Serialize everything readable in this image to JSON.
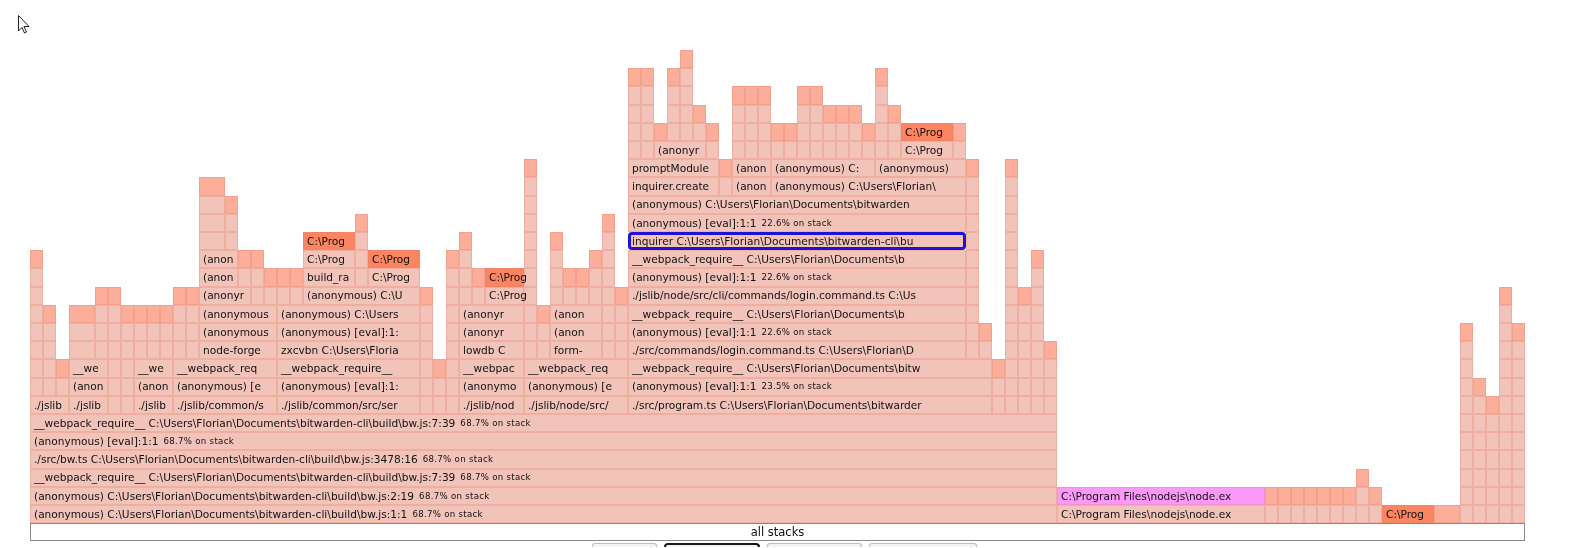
{
  "flame_graph": {
    "rows": [
      {
        "frames": [
          {
            "label": "C:\\Prog",
            "color": "#fa8560",
            "selected": false
          }
        ]
      },
      {
        "frames": [
          {
            "label": "(anonyr",
            "color": "#f2c3b9",
            "selected": false
          },
          {
            "label": "C:\\Prog",
            "color": "#f2c3b9",
            "selected": false
          }
        ]
      },
      {
        "frames": [
          {
            "label": "promptModule",
            "color": "#f2c3b9",
            "selected": false
          },
          {
            "label": "(anon",
            "color": "#f2c3b9",
            "selected": false
          },
          {
            "label": "(anonymous) C:",
            "color": "#f2c3b9",
            "selected": false
          },
          {
            "label": "(anonymous)",
            "color": "#f2c3b9",
            "selected": false
          }
        ]
      },
      {
        "frames": [
          {
            "label": "inquirer.create",
            "color": "#f2c3b9",
            "selected": false
          },
          {
            "label": "(anon",
            "color": "#f2c3b9",
            "selected": false
          },
          {
            "label": "(anonymous) C:\\Users\\Florian\\",
            "color": "#f2c3b9",
            "selected": false
          }
        ]
      },
      {
        "frames": [
          {
            "label": "(anonymous) C:\\Users\\Florian\\Documents\\bitwarden",
            "color": "#f2c3b9",
            "selected": false
          }
        ]
      },
      {
        "frames": [
          {
            "label": "(anonymous) [eval]:1:1",
            "share": "22.6% on stack",
            "color": "#f2c3b9",
            "selected": false
          }
        ]
      },
      {
        "frames": [
          {
            "label": "C:\\Prog",
            "color": "#fa8560",
            "selected": false
          },
          {
            "label": "inquirer C:\\Users\\Florian\\Documents\\bitwarden-cli\\bu",
            "color": "#f2c3b9",
            "selected": true
          }
        ]
      },
      {
        "frames": [
          {
            "label": "(anon",
            "color": "#f2c3b9",
            "selected": false
          },
          {
            "label": "C:\\Prog",
            "color": "#f2c3b9",
            "selected": false
          },
          {
            "label": "C:\\Prog",
            "color": "#fa8560",
            "selected": false
          },
          {
            "label": "__webpack_require__ C:\\Users\\Florian\\Documents\\b",
            "color": "#f2c3b9",
            "selected": false
          }
        ]
      },
      {
        "frames": [
          {
            "label": "(anon",
            "color": "#f2c3b9",
            "selected": false
          },
          {
            "label": "build_ra",
            "color": "#f2c3b9",
            "selected": false
          },
          {
            "label": "C:\\Prog",
            "color": "#f2c3b9",
            "selected": false
          },
          {
            "label": "C:\\Prog",
            "color": "#fa8560",
            "selected": false
          },
          {
            "label": "(anonymous) [eval]:1:1",
            "share": "22.6% on stack",
            "color": "#f2c3b9",
            "selected": false
          }
        ]
      },
      {
        "frames": [
          {
            "label": "(anonyr",
            "color": "#f2c3b9",
            "selected": false
          },
          {
            "label": "(anonymous) C:\\U",
            "color": "#f2c3b9",
            "selected": false
          },
          {
            "label": "C:\\Prog",
            "color": "#f2c3b9",
            "selected": false
          },
          {
            "label": "./jslib/node/src/cli/commands/login.command.ts C:\\Us",
            "color": "#f2c3b9",
            "selected": false
          }
        ]
      },
      {
        "frames": [
          {
            "label": "(anonymous",
            "color": "#f2c3b9",
            "selected": false
          },
          {
            "label": "(anonymous) C:\\Users",
            "color": "#f2c3b9",
            "selected": false
          },
          {
            "label": "(anonyr",
            "color": "#f2c3b9",
            "selected": false
          },
          {
            "label": "(anon",
            "color": "#f2c3b9",
            "selected": false
          },
          {
            "label": "__webpack_require__ C:\\Users\\Florian\\Documents\\b",
            "color": "#f2c3b9",
            "selected": false
          }
        ]
      },
      {
        "frames": [
          {
            "label": "(anonymous",
            "color": "#f2c3b9",
            "selected": false
          },
          {
            "label": "(anonymous) [eval]:1:",
            "color": "#f2c3b9",
            "selected": false
          },
          {
            "label": "(anonyr",
            "color": "#f2c3b9",
            "selected": false
          },
          {
            "label": "(anon",
            "color": "#f2c3b9",
            "selected": false
          },
          {
            "label": "(anonymous) [eval]:1:1",
            "share": "22.6% on stack",
            "color": "#f2c3b9",
            "selected": false
          }
        ]
      },
      {
        "frames": [
          {
            "label": "node-forge",
            "color": "#f2c3b9",
            "selected": false
          },
          {
            "label": "zxcvbn C:\\Users\\Floria",
            "color": "#f2c3b9",
            "selected": false
          },
          {
            "label": "lowdb C",
            "color": "#f2c3b9",
            "selected": false
          },
          {
            "label": "form-",
            "color": "#f2c3b9",
            "selected": false
          },
          {
            "label": "./src/commands/login.command.ts C:\\Users\\Florian\\D",
            "color": "#f2c3b9",
            "selected": false
          }
        ]
      },
      {
        "frames": [
          {
            "label": "__we",
            "color": "#f2c3b9",
            "selected": false
          },
          {
            "label": "__we",
            "color": "#f2c3b9",
            "selected": false
          },
          {
            "label": "__webpack_req",
            "color": "#f2c3b9",
            "selected": false
          },
          {
            "label": "__webpack_require__",
            "color": "#f2c3b9",
            "selected": false
          },
          {
            "label": "__webpac",
            "color": "#f2c3b9",
            "selected": false
          },
          {
            "label": "__webpack_req",
            "color": "#f2c3b9",
            "selected": false
          },
          {
            "label": "__webpack_require__ C:\\Users\\Florian\\Documents\\bitw",
            "color": "#f2c3b9",
            "selected": false
          }
        ]
      },
      {
        "frames": [
          {
            "label": "(anon",
            "color": "#f2c3b9",
            "selected": false
          },
          {
            "label": "(anon",
            "color": "#f2c3b9",
            "selected": false
          },
          {
            "label": "(anonymous) [e",
            "color": "#f2c3b9",
            "selected": false
          },
          {
            "label": "(anonymous) [eval]:1:",
            "color": "#f2c3b9",
            "selected": false
          },
          {
            "label": "(anonymo",
            "color": "#f2c3b9",
            "selected": false
          },
          {
            "label": "(anonymous) [e",
            "color": "#f2c3b9",
            "selected": false
          },
          {
            "label": "(anonymous) [eval]:1:1",
            "share": "23.5% on stack",
            "color": "#f2c3b9",
            "selected": false
          }
        ]
      },
      {
        "frames": [
          {
            "label": "./jslib",
            "color": "#f2c3b9",
            "selected": false
          },
          {
            "label": "./jslib",
            "color": "#f2c3b9",
            "selected": false
          },
          {
            "label": "./jslib",
            "color": "#f2c3b9",
            "selected": false
          },
          {
            "label": "./jslib/common/s",
            "color": "#f2c3b9",
            "selected": false
          },
          {
            "label": "./jslib/common/src/ser",
            "color": "#f2c3b9",
            "selected": false
          },
          {
            "label": "./jslib/nod",
            "color": "#f2c3b9",
            "selected": false
          },
          {
            "label": "./jslib/node/src/",
            "color": "#f2c3b9",
            "selected": false
          },
          {
            "label": "./src/program.ts C:\\Users\\Florian\\Documents\\bitwarder",
            "color": "#f2c3b9",
            "selected": false
          }
        ]
      },
      {
        "frames": [
          {
            "label": "__webpack_require__ C:\\Users\\Florian\\Documents\\bitwarden-cli\\build\\bw.js:7:39",
            "share": "68.7% on stack",
            "color": "#f2c3b9",
            "selected": false
          }
        ]
      },
      {
        "frames": [
          {
            "label": "(anonymous) [eval]:1:1",
            "share": "68.7% on stack",
            "color": "#f2c3b9",
            "selected": false
          }
        ]
      },
      {
        "frames": [
          {
            "label": "./src/bw.ts C:\\Users\\Florian\\Documents\\bitwarden-cli\\build\\bw.js:3478:16",
            "share": "68.7% on stack",
            "color": "#f2c3b9",
            "selected": false
          }
        ]
      },
      {
        "frames": [
          {
            "label": "__webpack_require__ C:\\Users\\Florian\\Documents\\bitwarden-cli\\build\\bw.js:7:39",
            "share": "68.7% on stack",
            "color": "#f2c3b9",
            "selected": false
          }
        ]
      },
      {
        "frames": [
          {
            "label": "(anonymous) C:\\Users\\Florian\\Documents\\bitwarden-cli\\build\\bw.js:2:19",
            "share": "68.7% on stack",
            "color": "#f2c3b9",
            "selected": false
          },
          {
            "label": "C:\\Program Files\\nodejs\\node.ex",
            "color": "#fc98fa",
            "selected": false
          }
        ]
      },
      {
        "frames": [
          {
            "label": "(anonymous) C:\\Users\\Florian\\Documents\\bitwarden-cli\\build\\bw.js:1:1",
            "share": "68.7% on stack",
            "color": "#f2c3b9",
            "selected": false
          },
          {
            "label": "C:\\Program Files\\nodejs\\node.ex",
            "color": "#f2c3b9",
            "selected": false
          },
          {
            "label": "C:\\Prog",
            "color": "#fa8560",
            "selected": false
          }
        ]
      }
    ],
    "root_label": "all stacks"
  },
  "buttons": [
    {
      "selected": false
    },
    {
      "selected": true
    },
    {
      "selected": false
    },
    {
      "selected": false
    }
  ]
}
